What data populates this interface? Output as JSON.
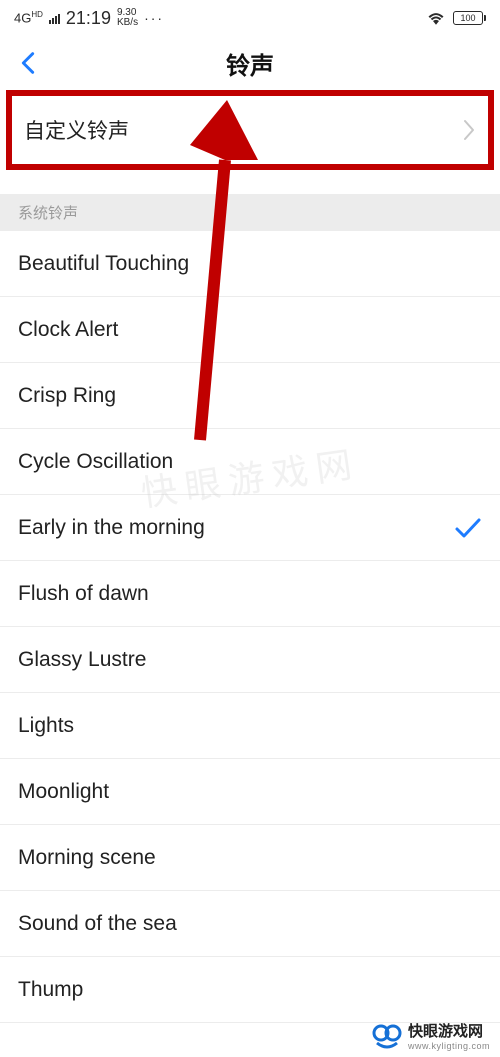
{
  "status": {
    "network": "4G",
    "network_sup": "HD",
    "time": "21:19",
    "speed_top": "9.30",
    "speed_bot": "KB/s",
    "dots": "···",
    "battery": "100"
  },
  "header": {
    "title": "铃声"
  },
  "custom_ringtone": {
    "label": "自定义铃声"
  },
  "section": {
    "label": "系统铃声"
  },
  "ringtones": [
    {
      "name": "Beautiful Touching",
      "selected": false
    },
    {
      "name": "Clock Alert",
      "selected": false
    },
    {
      "name": "Crisp Ring",
      "selected": false
    },
    {
      "name": "Cycle Oscillation",
      "selected": false
    },
    {
      "name": "Early in the morning",
      "selected": true
    },
    {
      "name": "Flush of dawn",
      "selected": false
    },
    {
      "name": "Glassy Lustre",
      "selected": false
    },
    {
      "name": "Lights",
      "selected": false
    },
    {
      "name": "Moonlight",
      "selected": false
    },
    {
      "name": "Morning scene",
      "selected": false
    },
    {
      "name": "Sound of the sea",
      "selected": false
    },
    {
      "name": "Thump",
      "selected": false
    }
  ],
  "watermark": {
    "title": "快眼游戏网",
    "url": "www.kyligting.com",
    "bg": "快眼游戏网"
  }
}
